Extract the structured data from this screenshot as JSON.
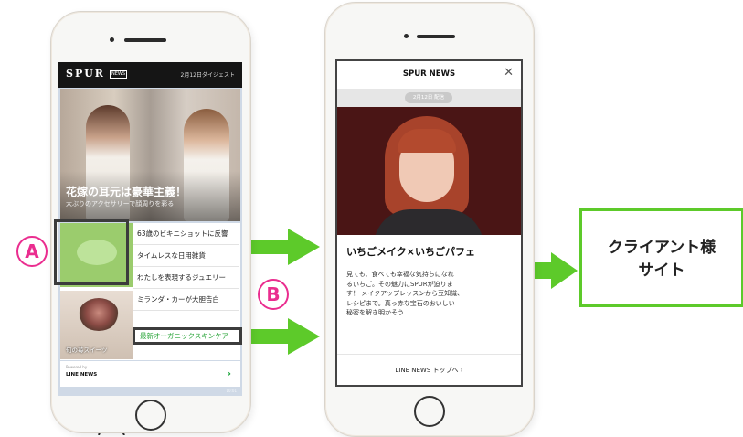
{
  "colors": {
    "arrow": "#5dca2a",
    "marker": "#ea2d8f",
    "highlight": "#3c3c3c"
  },
  "phone1": {
    "brand": "SPUR",
    "brand_badge": "NEWS",
    "digest": "2月12日ダイジェスト",
    "hero_title": "花嫁の耳元は豪華主義！",
    "hero_sub": "大ぶりのアクセサリーで顔周りを彩る",
    "items": [
      "63歳のビキニショットに反響",
      "タイムレスな日用雑貨",
      "わたしを表現するジュエリー",
      "ミランダ・カーが大胆告白",
      "最新オーガニックスキンケア"
    ],
    "thumb_b_caption": "旬の苺スイーツ",
    "powered_by": "Powered by",
    "footer_brand": "LINE NEWS",
    "time": "10:01"
  },
  "phone2": {
    "title": "SPUR NEWS",
    "date": "2月12日 配信",
    "article_title": "いちごメイク×いちごパフェ",
    "article_lines": [
      "見ても、食べても幸福な気持ちになれ",
      "るいちご。その魅力にSPURが迫りま",
      "す！ メイクアップレッスンから豆知識、",
      "レシピまで。真っ赤な宝石のおいしい",
      "秘密を解き明かそう"
    ],
    "footer_link": "LINE NEWS トップへ"
  },
  "markers": {
    "a": "A",
    "b": "B"
  },
  "client": {
    "line1": "クライアント様",
    "line2": "サイト"
  }
}
